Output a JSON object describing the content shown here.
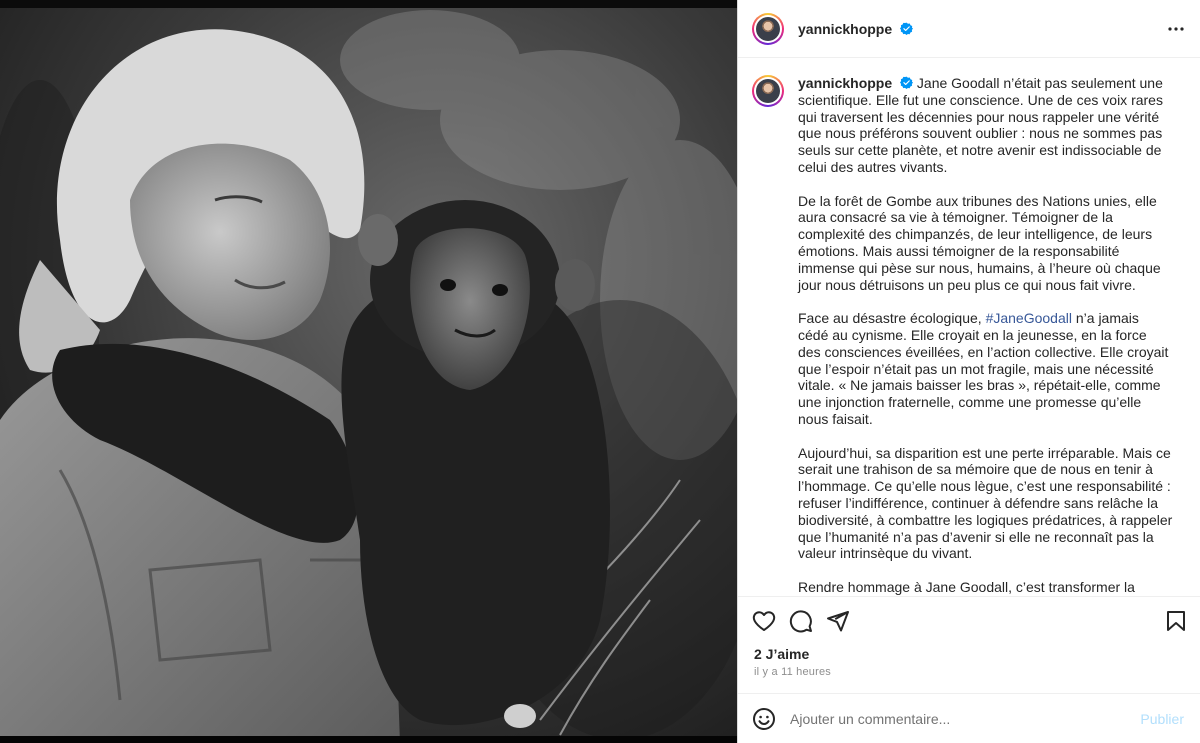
{
  "post": {
    "username": "yannickhoppe",
    "caption_paragraphs": [
      {
        "before": " Jane Goodall n’était pas seulement une scientifique. Elle fut une conscience. Une de ces voix rares qui traversent les décennies pour nous rappeler une vérité que nous préférons souvent oublier : nous ne sommes pas seuls sur cette planète, et notre avenir est indissociable de celui des autres vivants."
      },
      {
        "before": "De la forêt de Gombe aux tribunes des Nations unies, elle aura consacré sa vie à témoigner. Témoigner de la complexité des chimpanzés, de leur intelligence, de leurs émotions. Mais aussi témoigner de la responsabilité immense qui pèse sur nous, humains, à l’heure où chaque jour nous détruisons un peu plus ce qui nous fait vivre."
      },
      {
        "before": "Face au désastre écologique, ",
        "hashtag": "#JaneGoodall",
        "after": " n’a jamais cédé au cynisme. Elle croyait en la jeunesse, en la force des consciences éveillées, en l’action collective. Elle croyait que l’espoir n’était pas un mot fragile, mais une nécessité vitale. « Ne jamais baisser les bras », répétait-elle, comme une injonction fraternelle, comme une promesse qu’elle nous faisait."
      },
      {
        "before": "Aujourd’hui, sa disparition est une perte irréparable. Mais ce serait une trahison de sa mémoire que de nous en tenir à l’hommage. Ce qu’elle nous lègue, c’est une responsabilité : refuser l’indifférence, continuer à défendre sans relâche la biodiversité, à combattre les logiques prédatrices, à rappeler que l’humanité n’a pas d’avenir si elle ne reconnaît pas la valeur intrinsèque du vivant."
      },
      {
        "before": "Rendre hommage à Jane Goodall, c’est transformer la douleur en action, la mémoire en combat, l’admiration en courage. C’est"
      }
    ],
    "likes": "2 J’aime",
    "timestamp": "il y a 11 heures"
  },
  "comment": {
    "placeholder": "Ajouter un commentaire...",
    "publish_label": "Publier"
  },
  "icons": {
    "verified": "verified-badge-icon",
    "more": "more-options-icon",
    "like": "heart-icon",
    "comment": "comment-bubble-icon",
    "share": "paper-plane-icon",
    "save": "bookmark-icon",
    "emoji": "emoji-smiley-icon"
  },
  "colors": {
    "verified_blue": "#0095f6",
    "hashtag": "#385898",
    "publish_disabled": "#b2dffc"
  }
}
